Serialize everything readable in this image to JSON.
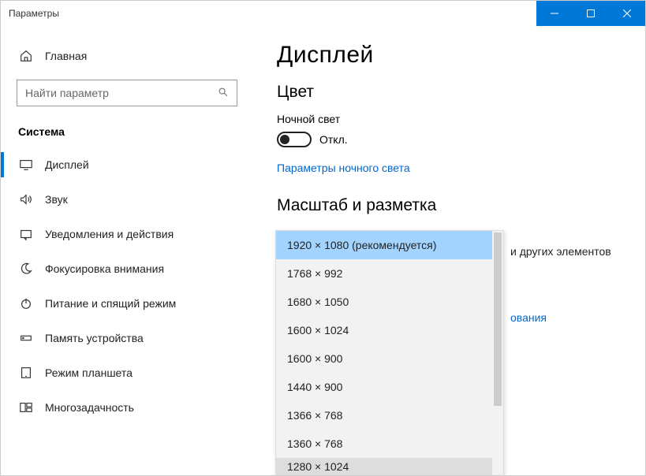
{
  "window": {
    "title": "Параметры"
  },
  "sidebar": {
    "home": "Главная",
    "search_placeholder": "Найти параметр",
    "category": "Система",
    "items": [
      {
        "label": "Дисплей"
      },
      {
        "label": "Звук"
      },
      {
        "label": "Уведомления и действия"
      },
      {
        "label": "Фокусировка внимания"
      },
      {
        "label": "Питание и спящий режим"
      },
      {
        "label": "Память устройства"
      },
      {
        "label": "Режим планшета"
      },
      {
        "label": "Многозадачность"
      }
    ]
  },
  "content": {
    "heading": "Дисплей",
    "color_heading": "Цвет",
    "nightlight_label": "Ночной свет",
    "toggle_state": "Откл.",
    "nightlight_link": "Параметры ночного света",
    "scale_heading": "Масштаб и разметка",
    "peek_right": "и других элементов",
    "peek_link_suffix": "ования"
  },
  "dropdown": {
    "options": [
      "1920 × 1080 (рекомендуется)",
      "1768 × 992",
      "1680 × 1050",
      "1600 × 1024",
      "1600 × 900",
      "1440 × 900",
      "1366 × 768",
      "1360 × 768",
      "1280 × 1024"
    ]
  }
}
